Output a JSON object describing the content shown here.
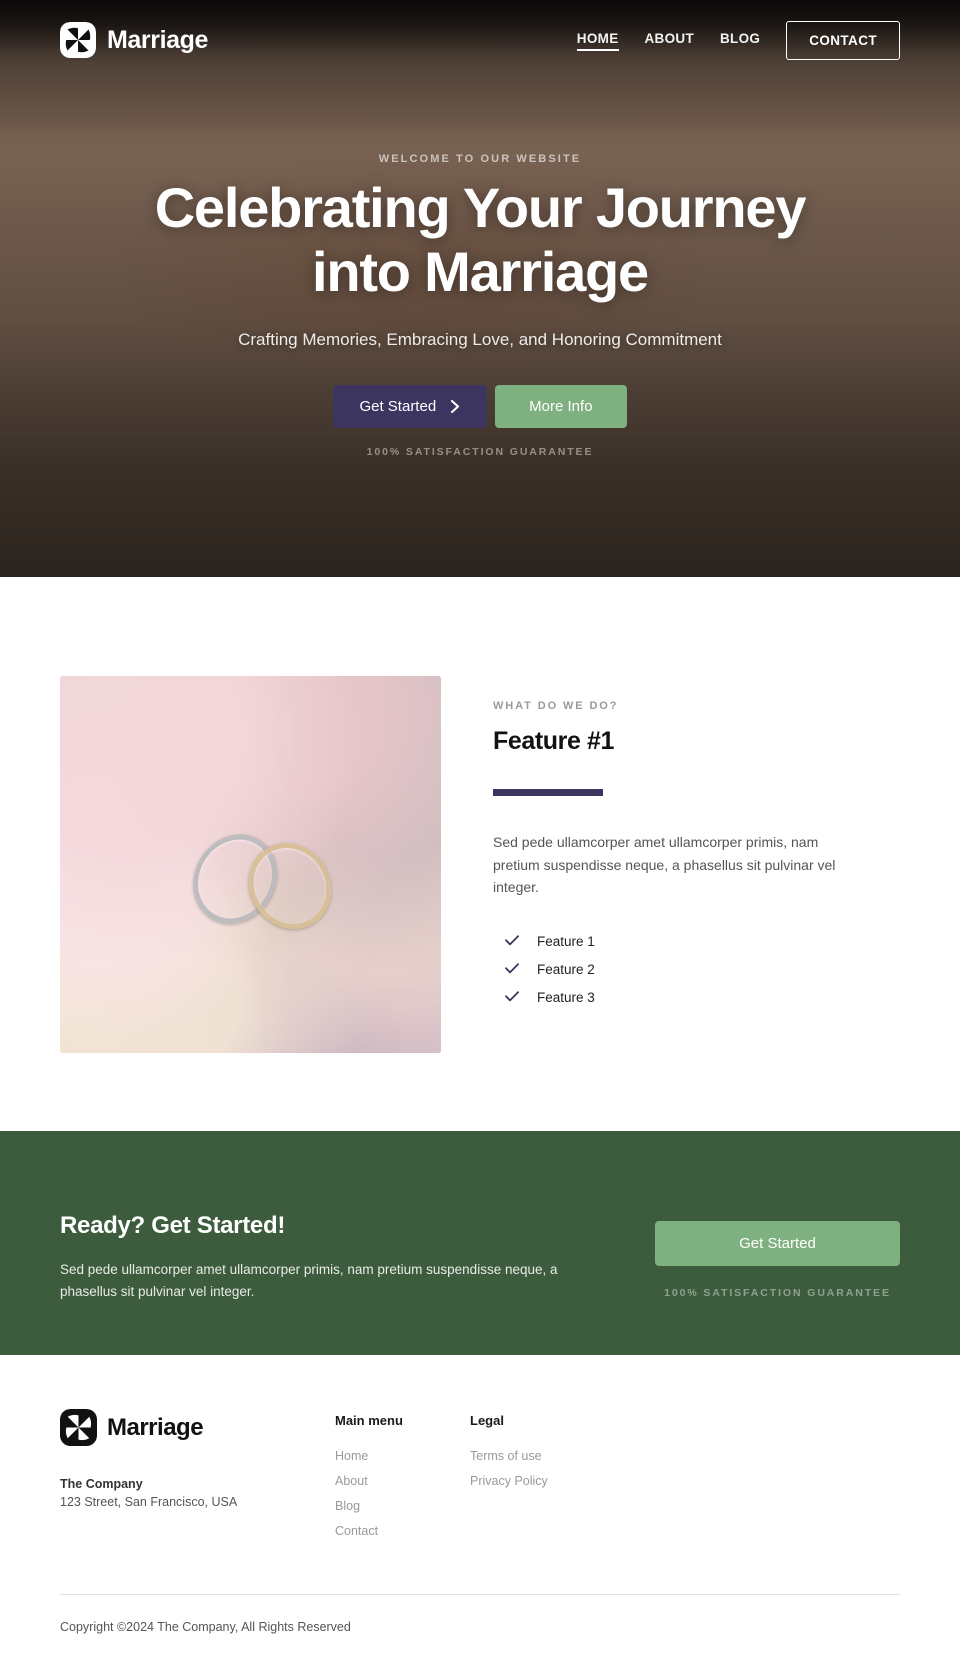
{
  "brand": {
    "name": "Marriage",
    "logo_icon": "pinwheel-logo-icon"
  },
  "nav": {
    "links": [
      {
        "label": "HOME",
        "active": true
      },
      {
        "label": "ABOUT",
        "active": false
      },
      {
        "label": "BLOG",
        "active": false
      }
    ],
    "contact_label": "CONTACT"
  },
  "hero": {
    "eyebrow": "WELCOME TO OUR WEBSITE",
    "title": "Celebrating Your Journey into Marriage",
    "subtitle": "Crafting Memories, Embracing Love, and Honoring Commitment",
    "primary_button": "Get Started",
    "primary_button_icon": "chevron-right-icon",
    "secondary_button": "More Info",
    "guarantee": "100% SATISFACTION GUARANTEE"
  },
  "feature": {
    "eyebrow": "WHAT DO WE DO?",
    "title": "Feature #1",
    "paragraph": "Sed pede ullamcorper amet ullamcorper primis, nam pretium suspendisse neque, a phasellus sit pulvinar vel integer.",
    "items": [
      {
        "label": "Feature 1",
        "icon": "check-icon"
      },
      {
        "label": "Feature 2",
        "icon": "check-icon"
      },
      {
        "label": "Feature 3",
        "icon": "check-icon"
      }
    ],
    "image_alt": "wedding-rings-photo"
  },
  "cta": {
    "title": "Ready? Get Started!",
    "text": "Sed pede ullamcorper amet ullamcorper primis, nam pretium suspendisse neque, a phasellus sit pulvinar vel integer.",
    "button": "Get Started",
    "guarantee": "100% SATISFACTION GUARANTEE"
  },
  "footer": {
    "company_label": "The Company",
    "address": "123 Street, San Francisco, USA",
    "menu": {
      "title": "Main menu",
      "links": [
        "Home",
        "About",
        "Blog",
        "Contact"
      ]
    },
    "legal": {
      "title": "Legal",
      "links": [
        "Terms of use",
        "Privacy Policy"
      ]
    },
    "copyright": "Copyright ©2024 The Company, All Rights Reserved"
  },
  "colors": {
    "accent_navy": "#3b3560",
    "accent_green": "#7fb07f",
    "cta_bg": "#3d5c3d"
  }
}
